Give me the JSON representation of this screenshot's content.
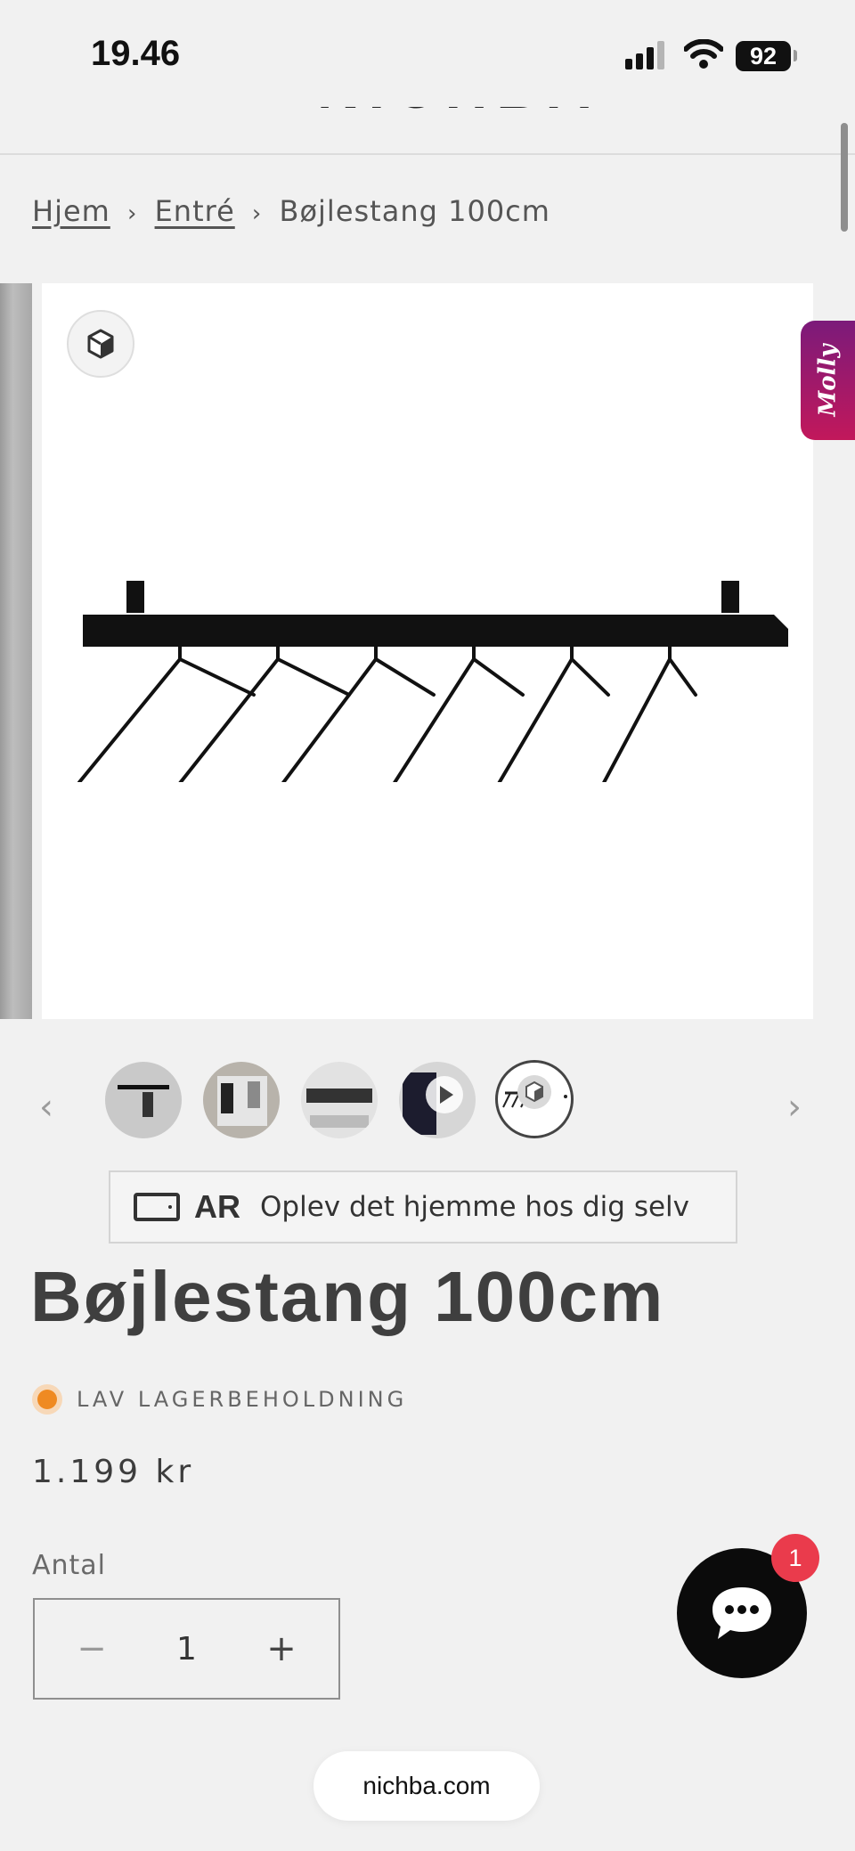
{
  "status_bar": {
    "time": "19.46",
    "battery": "92"
  },
  "header": {
    "logo": "NICHBA"
  },
  "breadcrumb": {
    "items": [
      {
        "label": "Hjem",
        "link": true
      },
      {
        "label": "Entré",
        "link": true
      },
      {
        "label": "Bøjlestang 100cm",
        "link": false
      }
    ],
    "separator": "›"
  },
  "gallery": {
    "side_tab": "Molly",
    "prev_icon": "chevron-left-icon",
    "next_icon": "chevron-right-icon",
    "thumbnails": [
      "photo",
      "photo",
      "photo",
      "video",
      "3d-model"
    ],
    "selected_index": 4
  },
  "ar_button": {
    "ar_label": "AR",
    "text": "Oplev det hjemme hos dig selv"
  },
  "product": {
    "title": "Bøjlestang 100cm",
    "stock_status": "LAV LAGERBEHOLDNING",
    "price": "1.199 kr"
  },
  "quantity": {
    "label": "Antal",
    "value": "1",
    "minus": "−",
    "plus": "+"
  },
  "chat": {
    "badge_count": "1"
  },
  "browser": {
    "url": "nichba.com"
  },
  "colors": {
    "stock_dot": "#ef8a22",
    "chat_badge": "#ea3b4c",
    "molly_tab": "#a0176a"
  }
}
